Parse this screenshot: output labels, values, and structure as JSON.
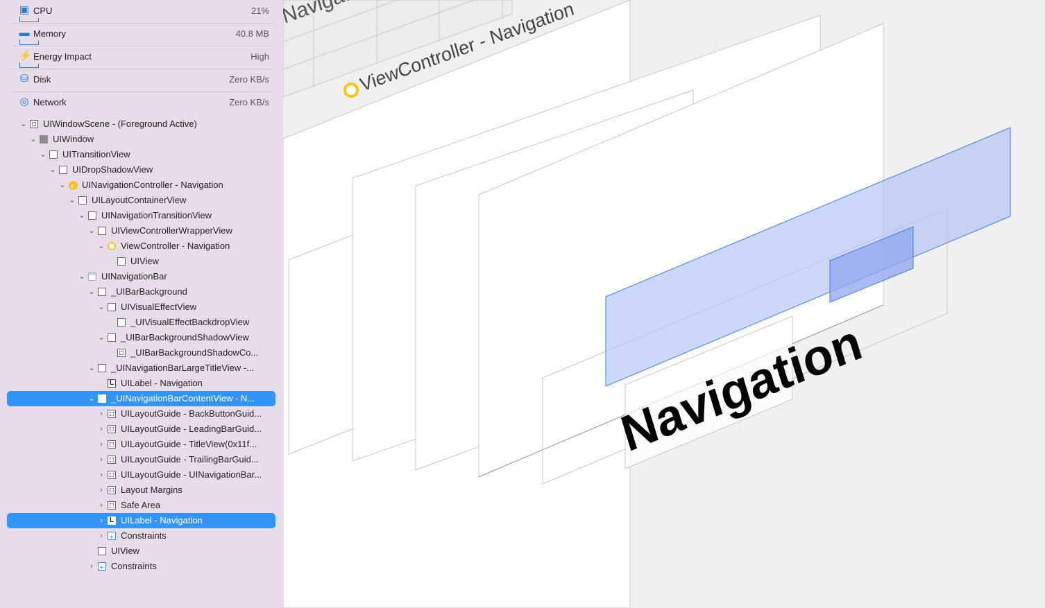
{
  "gauges": [
    {
      "label": "CPU",
      "value": "21%",
      "icon": "cpu-icon"
    },
    {
      "label": "Memory",
      "value": "40.8 MB",
      "icon": "memory-icon"
    },
    {
      "label": "Energy Impact",
      "value": "High",
      "icon": "energy-icon"
    },
    {
      "label": "Disk",
      "value": "Zero KB/s",
      "icon": "disk-icon"
    },
    {
      "label": "Network",
      "value": "Zero KB/s",
      "icon": "network-icon"
    }
  ],
  "tree": [
    {
      "label": "UIWindowScene - (Foreground Active)",
      "depth": 0,
      "chevron": "down",
      "icon": "window-scene"
    },
    {
      "label": "UIWindow",
      "depth": 1,
      "chevron": "down",
      "icon": "filled"
    },
    {
      "label": "UITransitionView",
      "depth": 2,
      "chevron": "down",
      "icon": "view"
    },
    {
      "label": "UIDropShadowView",
      "depth": 3,
      "chevron": "down",
      "icon": "view"
    },
    {
      "label": "UINavigationController - Navigation",
      "depth": 4,
      "chevron": "down",
      "icon": "nav"
    },
    {
      "label": "UILayoutContainerView",
      "depth": 5,
      "chevron": "down",
      "icon": "view"
    },
    {
      "label": "UINavigationTransitionView",
      "depth": 6,
      "chevron": "down",
      "icon": "view"
    },
    {
      "label": "UIViewControllerWrapperView",
      "depth": 7,
      "chevron": "down",
      "icon": "view"
    },
    {
      "label": "ViewController - Navigation",
      "depth": 8,
      "chevron": "down",
      "icon": "vc"
    },
    {
      "label": "UIView",
      "depth": 9,
      "chevron": "none",
      "icon": "view"
    },
    {
      "label": "UINavigationBar",
      "depth": 6,
      "chevron": "down",
      "icon": "bar"
    },
    {
      "label": "_UIBarBackground",
      "depth": 7,
      "chevron": "down",
      "icon": "view"
    },
    {
      "label": "UIVisualEffectView",
      "depth": 8,
      "chevron": "down",
      "icon": "view"
    },
    {
      "label": "_UIVisualEffectBackdropView",
      "depth": 9,
      "chevron": "none",
      "icon": "view"
    },
    {
      "label": "_UIBarBackgroundShadowView",
      "depth": 8,
      "chevron": "down",
      "icon": "view"
    },
    {
      "label": "_UIBarBackgroundShadowCo...",
      "depth": 9,
      "chevron": "none",
      "icon": "img"
    },
    {
      "label": "_UINavigationBarLargeTitleView -...",
      "depth": 7,
      "chevron": "down",
      "icon": "view"
    },
    {
      "label": "UILabel - Navigation",
      "depth": 8,
      "chevron": "none",
      "icon": "label"
    },
    {
      "label": "_UINavigationBarContentView - N...",
      "depth": 7,
      "chevron": "down",
      "icon": "view",
      "selected": true
    },
    {
      "label": "UILayoutGuide - BackButtonGuid...",
      "depth": 8,
      "chevron": "right",
      "icon": "guide"
    },
    {
      "label": "UILayoutGuide - LeadingBarGuid...",
      "depth": 8,
      "chevron": "right",
      "icon": "guide"
    },
    {
      "label": "UILayoutGuide - TitleView(0x11f...",
      "depth": 8,
      "chevron": "right",
      "icon": "guide"
    },
    {
      "label": "UILayoutGuide - TrailingBarGuid...",
      "depth": 8,
      "chevron": "right",
      "icon": "guide"
    },
    {
      "label": "UILayoutGuide - UINavigationBar...",
      "depth": 8,
      "chevron": "right",
      "icon": "guide"
    },
    {
      "label": "Layout Margins",
      "depth": 8,
      "chevron": "right",
      "icon": "guide"
    },
    {
      "label": "Safe Area",
      "depth": 8,
      "chevron": "right",
      "icon": "guide"
    },
    {
      "label": "UILabel - Navigation",
      "depth": 8,
      "chevron": "right",
      "icon": "label",
      "selected": true
    },
    {
      "label": "Constraints",
      "depth": 8,
      "chevron": "right",
      "icon": "constraint"
    },
    {
      "label": "UIView",
      "depth": 7,
      "chevron": "none",
      "icon": "view"
    },
    {
      "label": "Constraints",
      "depth": 7,
      "chevron": "right",
      "icon": "constraint"
    }
  ],
  "canvas": {
    "top_label": "Navigation",
    "vc_label": "ViewController - Navigation",
    "large_title": "Navigation"
  },
  "colors": {
    "sidebar_bg": "#e9dcea",
    "selection": "#3395f7",
    "accent": "#1e7bd8",
    "highlight_fill": "#aebff5",
    "vc_icon": "#f7c51b"
  }
}
